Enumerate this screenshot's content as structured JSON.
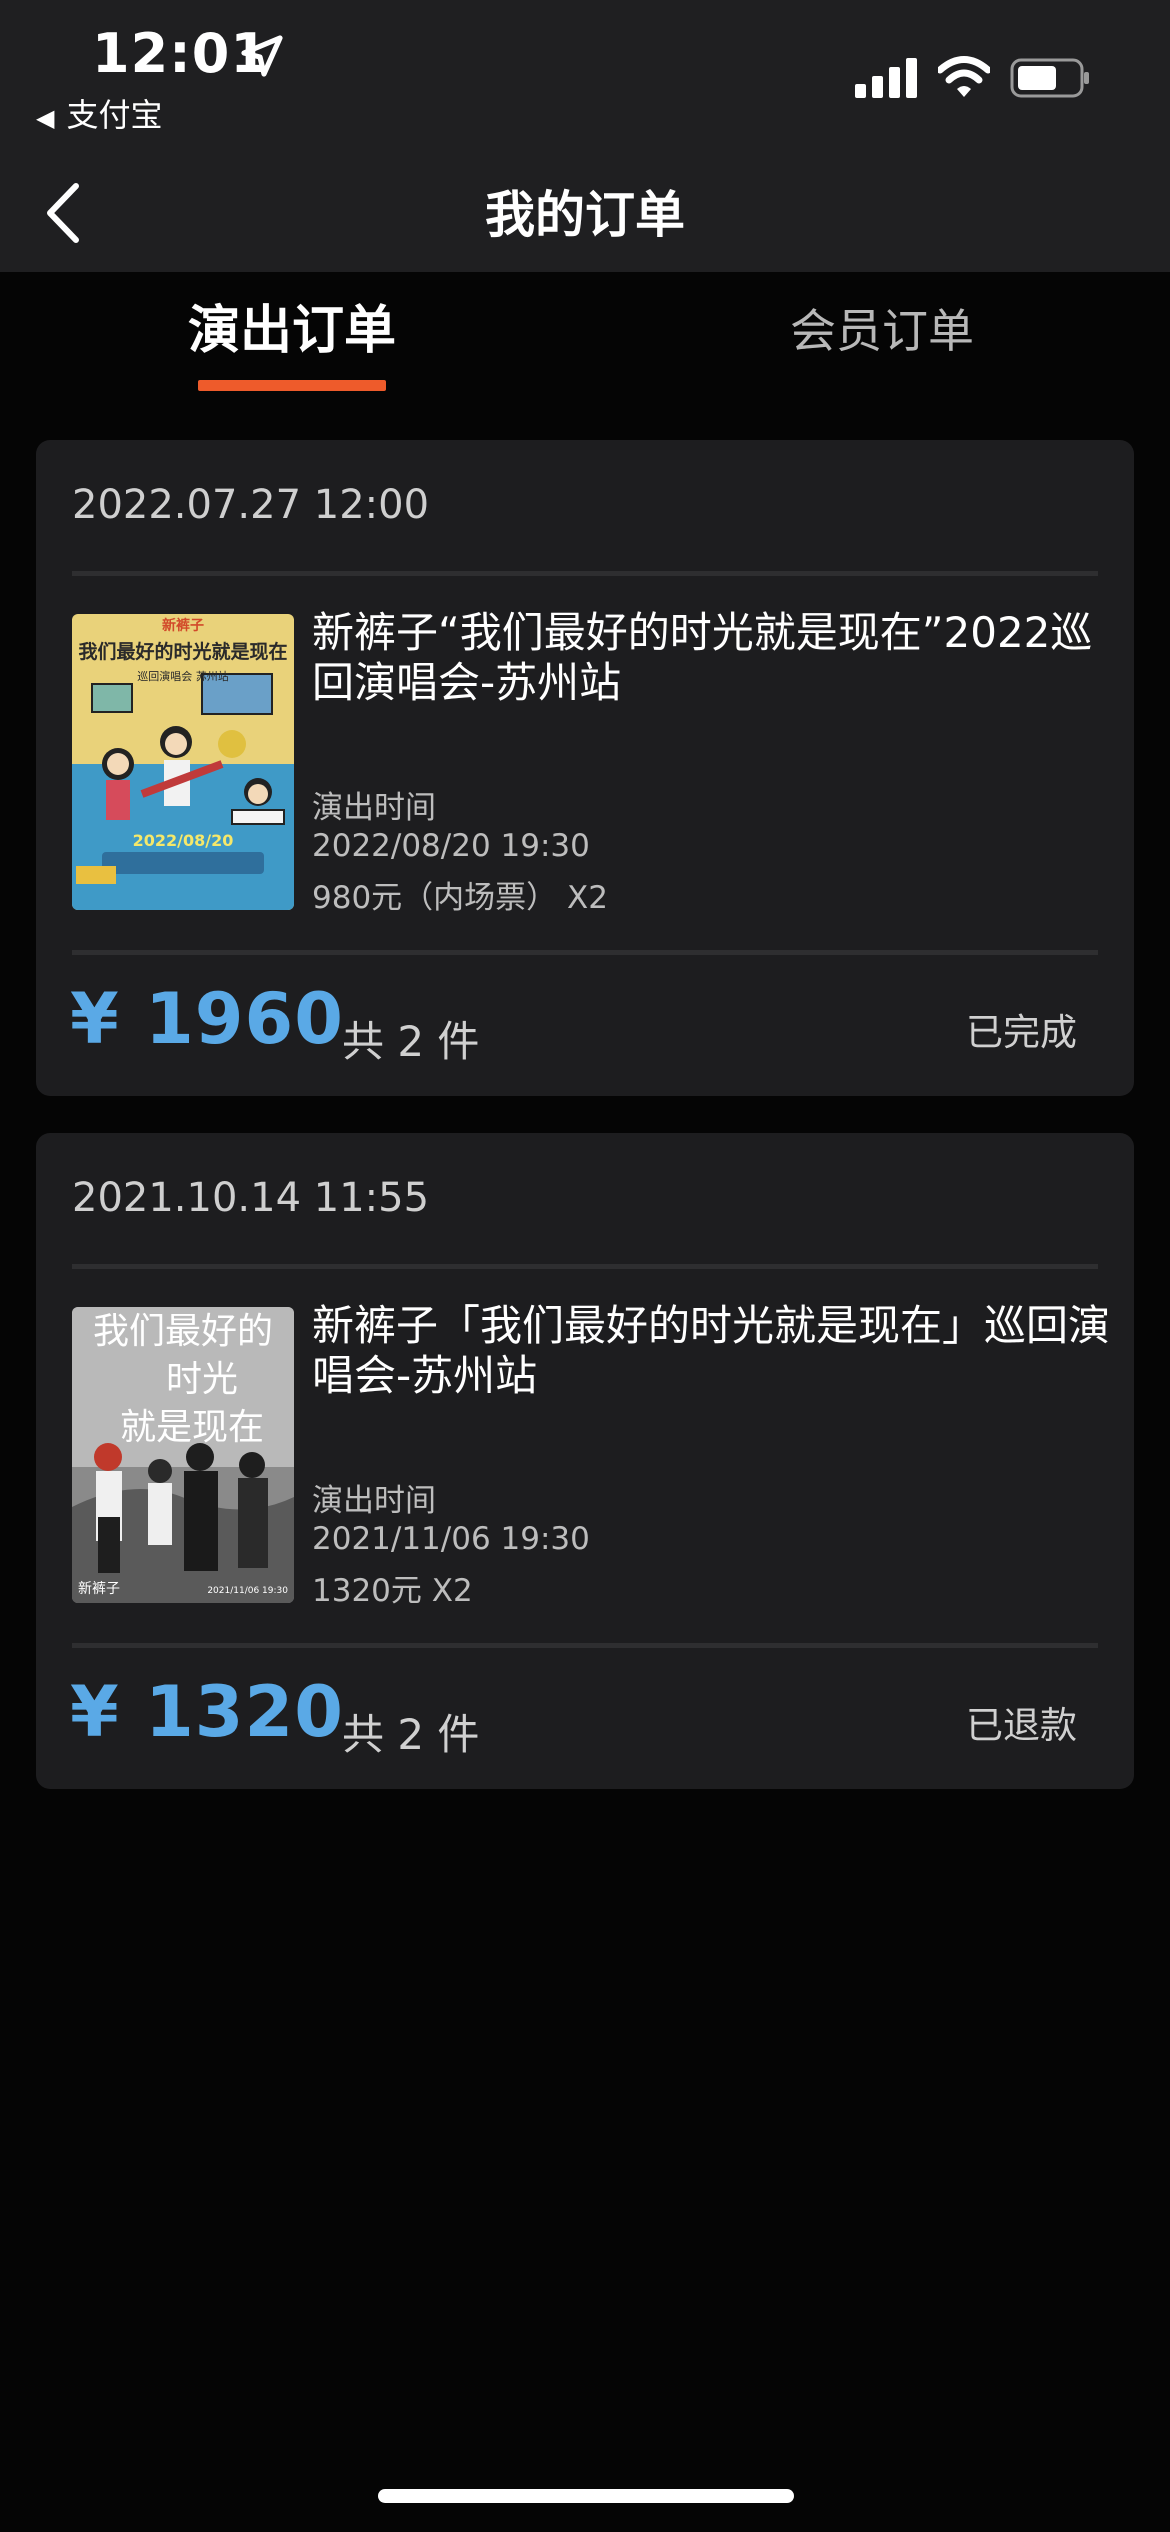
{
  "status_bar": {
    "time": "12:01",
    "back_app": "支付宝"
  },
  "nav": {
    "title": "我的订单"
  },
  "tabs": [
    {
      "label": "演出订单",
      "active": true
    },
    {
      "label": "会员订单",
      "active": false
    }
  ],
  "colors": {
    "accent": "#ee5b2b",
    "price": "#5aa9e6",
    "card_bg": "#1d1d1f",
    "page_bg": "#050505"
  },
  "orders": [
    {
      "date": "2022.07.27 12:00",
      "title": "新裤子“我们最好的时光就是现在”2022巡回演唱会-苏州站",
      "perf_label": "演出时间",
      "perf_time": "2022/08/20  19:30",
      "price_line": "980元（内场票） X2",
      "total": "¥ 1960",
      "count": "共 2 件",
      "status": "已完成",
      "poster": {
        "band": "新裤子",
        "headline": "我们最好的时光就是现在",
        "sub": "巡回演唱会 苏州站",
        "date": "2022/08/20"
      }
    },
    {
      "date": "2021.10.14 11:55",
      "title": "新裤子「我们最好的时光就是现在」巡回演唱会-苏州站",
      "perf_label": "演出时间",
      "perf_time": "2021/11/06  19:30",
      "price_line": "1320元 X2",
      "total": "¥ 1320",
      "count": "共 2 件",
      "status": "已退款",
      "poster": {
        "line1": "我们最好的",
        "line2": "时光",
        "line3": "就是现在",
        "band": "新裤子",
        "date": "2021/11/06 19:30"
      }
    }
  ]
}
